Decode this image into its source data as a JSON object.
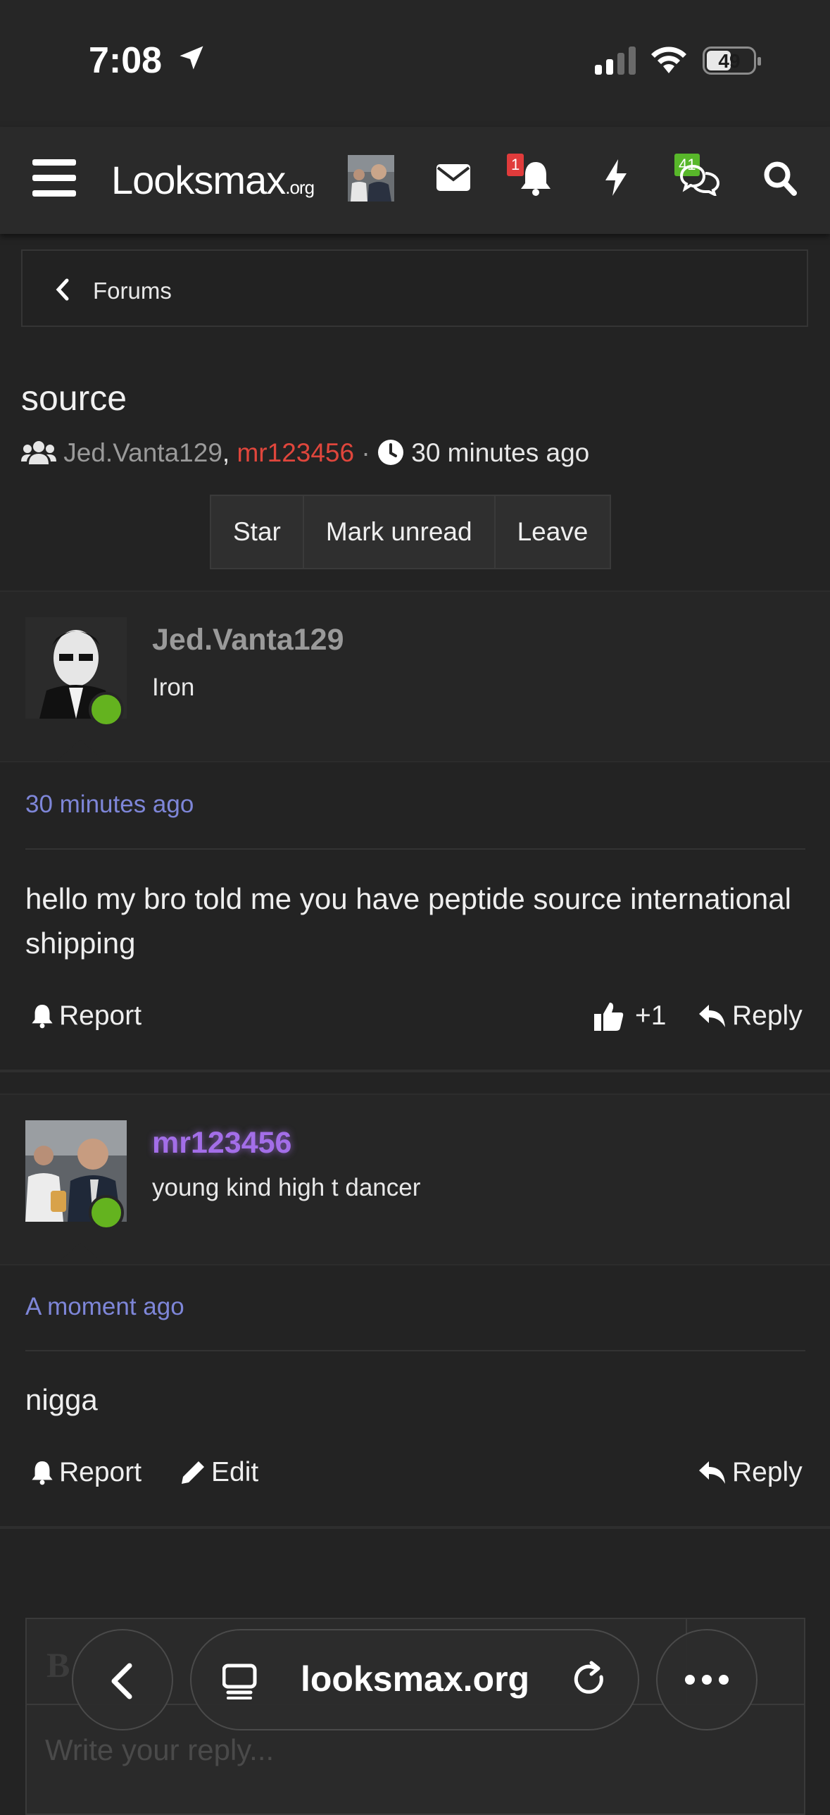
{
  "status_bar": {
    "time": "7:08",
    "battery": "49"
  },
  "nav": {
    "logo_main": "Looksmax",
    "logo_suffix": ".org",
    "alerts_count": "1",
    "conversations_count": "41"
  },
  "breadcrumb": {
    "label": "Forums"
  },
  "conversation": {
    "title": "source",
    "participant_1": "Jed.Vanta129",
    "participant_2": "mr123456",
    "separator": ",",
    "dot": "·",
    "started": "30 minutes ago",
    "buttons": {
      "star": "Star",
      "mark_unread": "Mark unread",
      "leave": "Leave"
    }
  },
  "messages": [
    {
      "username": "Jed.Vanta129",
      "user_title": "Iron",
      "time": "30 minutes ago",
      "body": "hello my bro told me you have peptide source international shipping",
      "report": "Report",
      "likes": "+1",
      "reply": "Reply"
    },
    {
      "username": "mr123456",
      "user_title": "young kind high t dancer",
      "time": "A moment ago",
      "body": "nigga",
      "report": "Report",
      "edit": "Edit",
      "reply": "Reply"
    }
  ],
  "reply_box": {
    "placeholder": "Write your reply..."
  },
  "browser": {
    "url": "looksmax.org"
  },
  "colors": {
    "accent_blue": "#7e86d8",
    "username_red": "#e0463c",
    "username_purple": "#a36ee8",
    "online_green": "#64b31f"
  }
}
